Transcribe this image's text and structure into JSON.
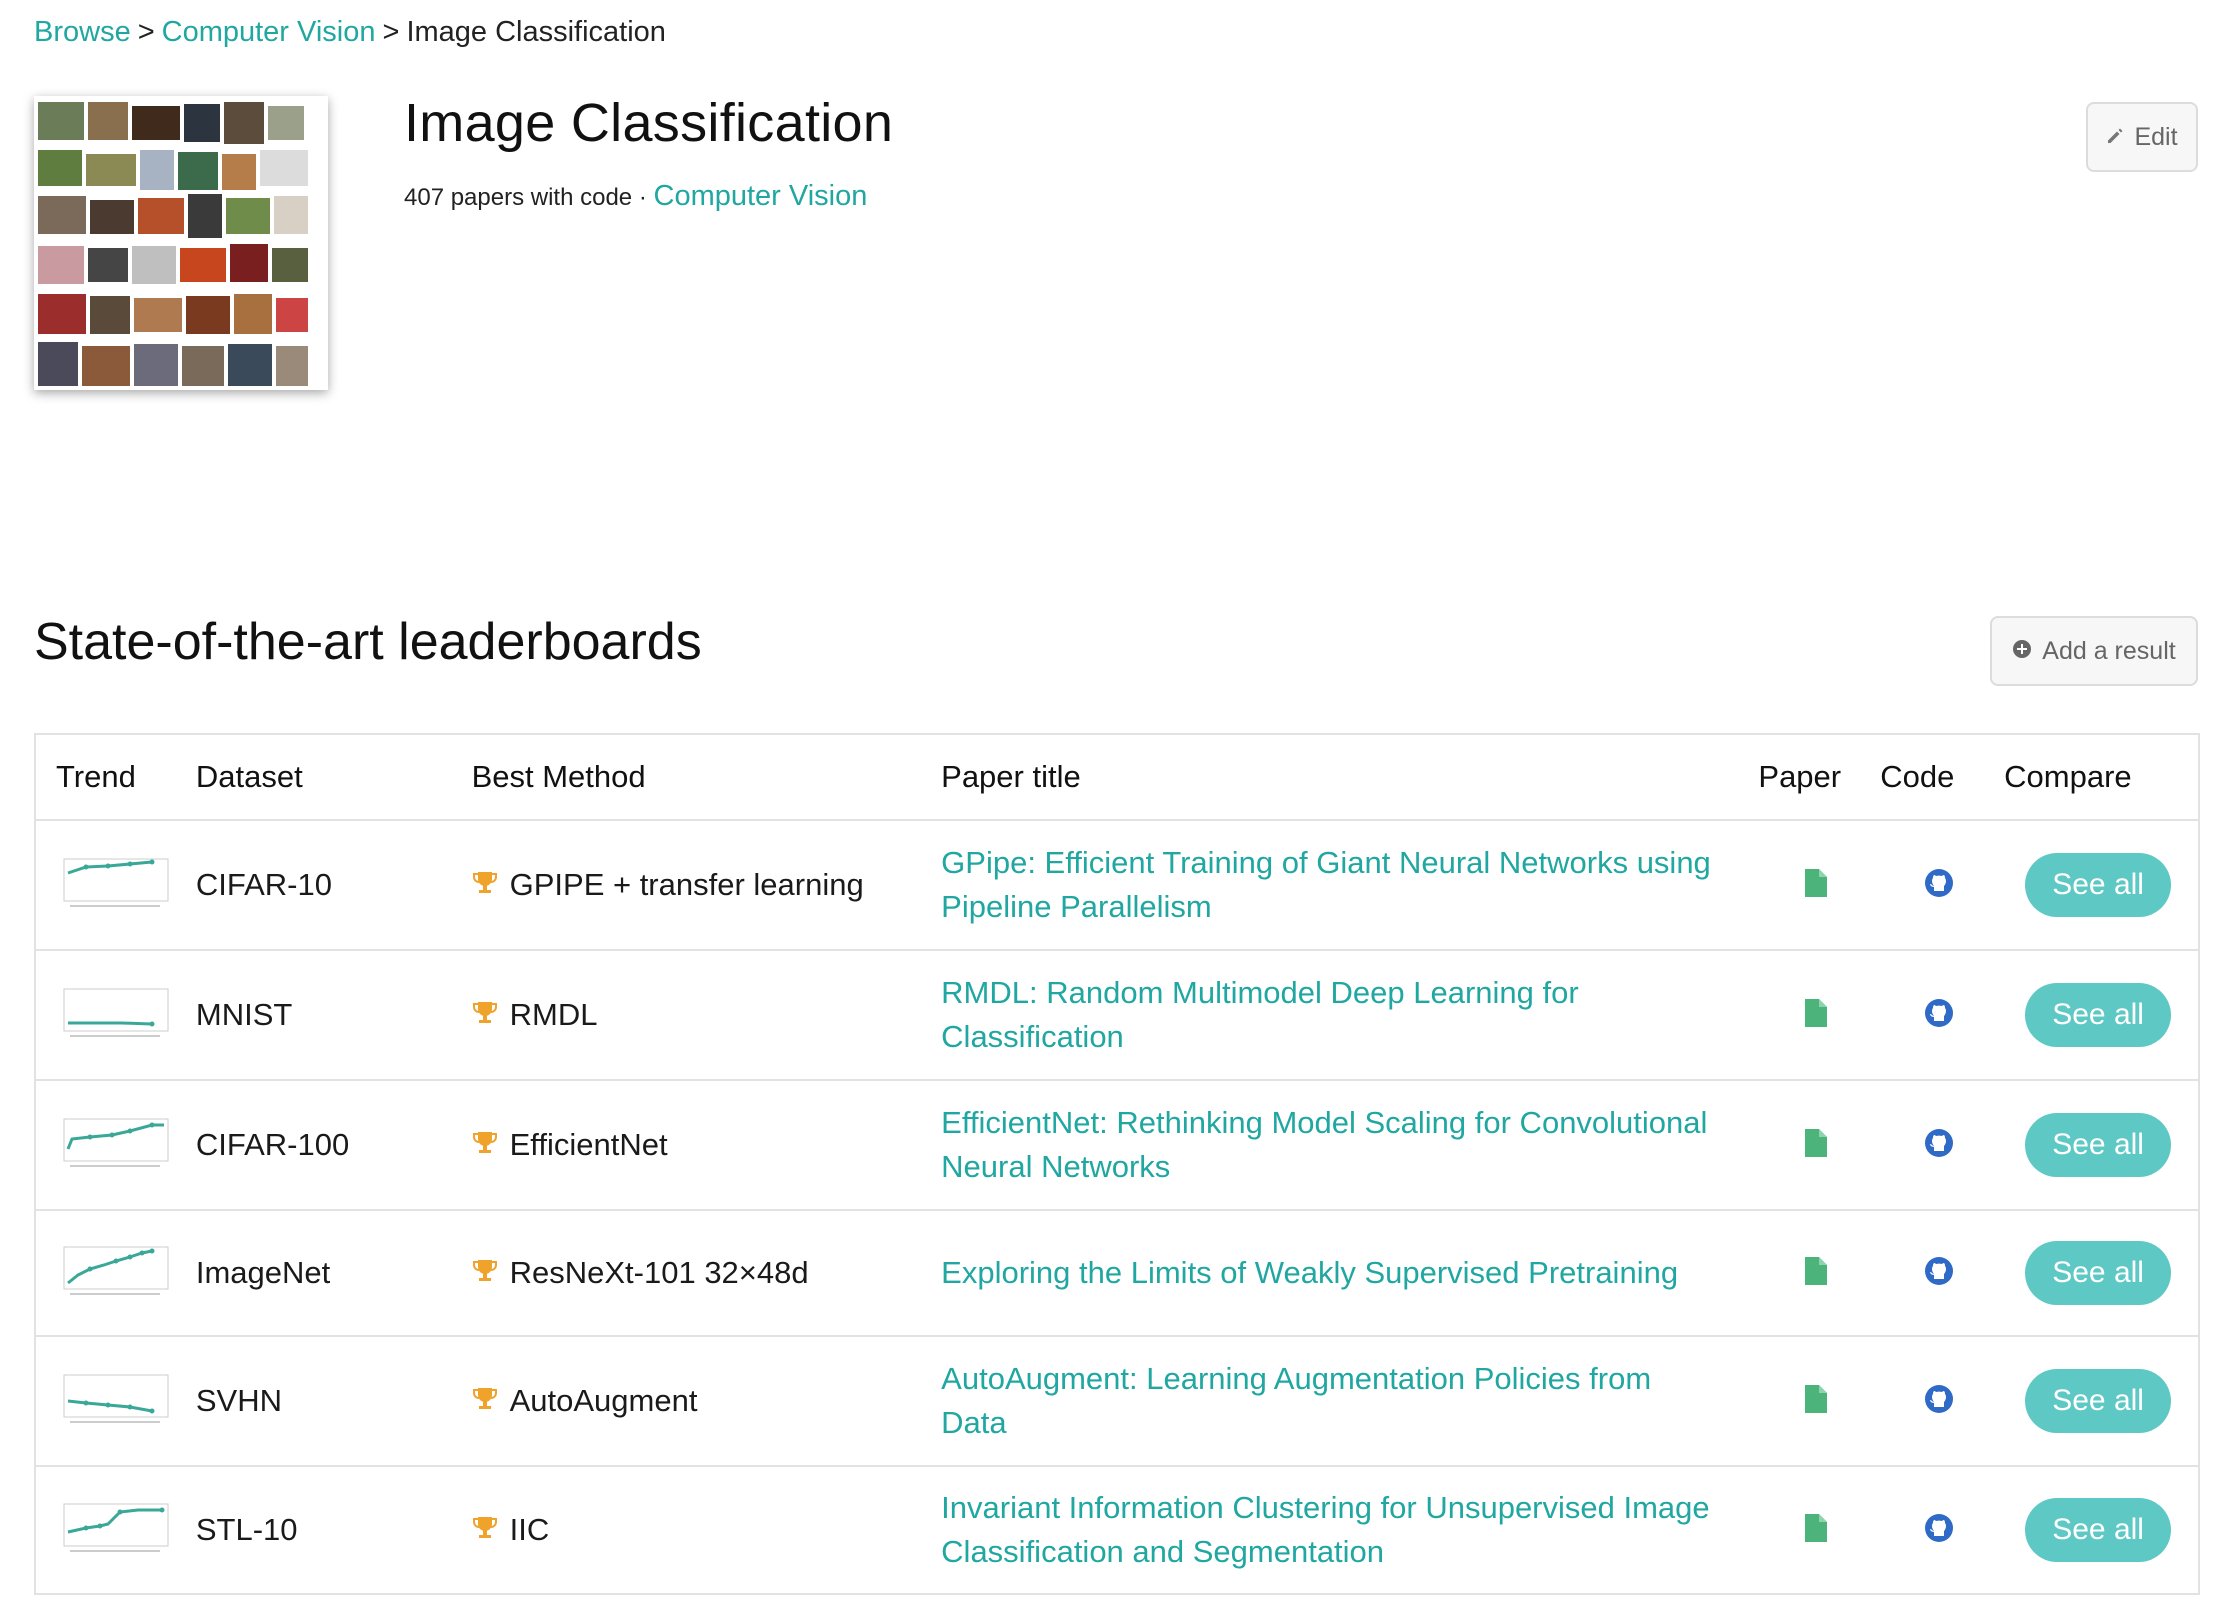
{
  "breadcrumb": {
    "browse": "Browse",
    "sep1": ">",
    "cv": "Computer Vision",
    "sep2": ">",
    "current": "Image Classification"
  },
  "task": {
    "title": "Image Classification",
    "papers_count": "407 papers with code",
    "dot": "·",
    "area": "Computer Vision",
    "edit_label": "Edit"
  },
  "leaderboards": {
    "title": "State-of-the-art leaderboards",
    "add_result_label": "Add a result",
    "columns": {
      "trend": "Trend",
      "dataset": "Dataset",
      "best_method": "Best Method",
      "paper_title": "Paper title",
      "paper": "Paper",
      "code": "Code",
      "compare": "Compare"
    },
    "rows": [
      {
        "dataset": "CIFAR-10",
        "method": "GPIPE + transfer learning",
        "title": "GPipe: Efficient Training of Giant Neural Networks using Pipeline Parallelism",
        "compare": "See all"
      },
      {
        "dataset": "MNIST",
        "method": "RMDL",
        "title": "RMDL: Random Multimodel Deep Learning for Classification",
        "compare": "See all"
      },
      {
        "dataset": "CIFAR-100",
        "method": "EfficientNet",
        "title": "EfficientNet: Rethinking Model Scaling for Convolutional Neural Networks",
        "compare": "See all"
      },
      {
        "dataset": "ImageNet",
        "method": "ResNeXt-101 32×48d",
        "title": "Exploring the Limits of Weakly Supervised Pretraining",
        "compare": "See all"
      },
      {
        "dataset": "SVHN",
        "method": "AutoAugment",
        "title": "AutoAugment: Learning Augmentation Policies from Data",
        "compare": "See all"
      },
      {
        "dataset": "STL-10",
        "method": "IIC",
        "title": "Invariant Information Clustering for Unsupervised Image Classification and Segmentation",
        "compare": "See all"
      }
    ]
  },
  "icons": {
    "edit": "pencil-icon",
    "add": "plus-circle-icon",
    "trophy": "trophy-icon",
    "paper": "file-icon",
    "code": "github-icon"
  },
  "colors": {
    "link": "#21a7a1",
    "button": "#5ec8c4",
    "trophy": "#f0a32a",
    "file": "#4cb37b",
    "github": "#2f6ac7"
  }
}
